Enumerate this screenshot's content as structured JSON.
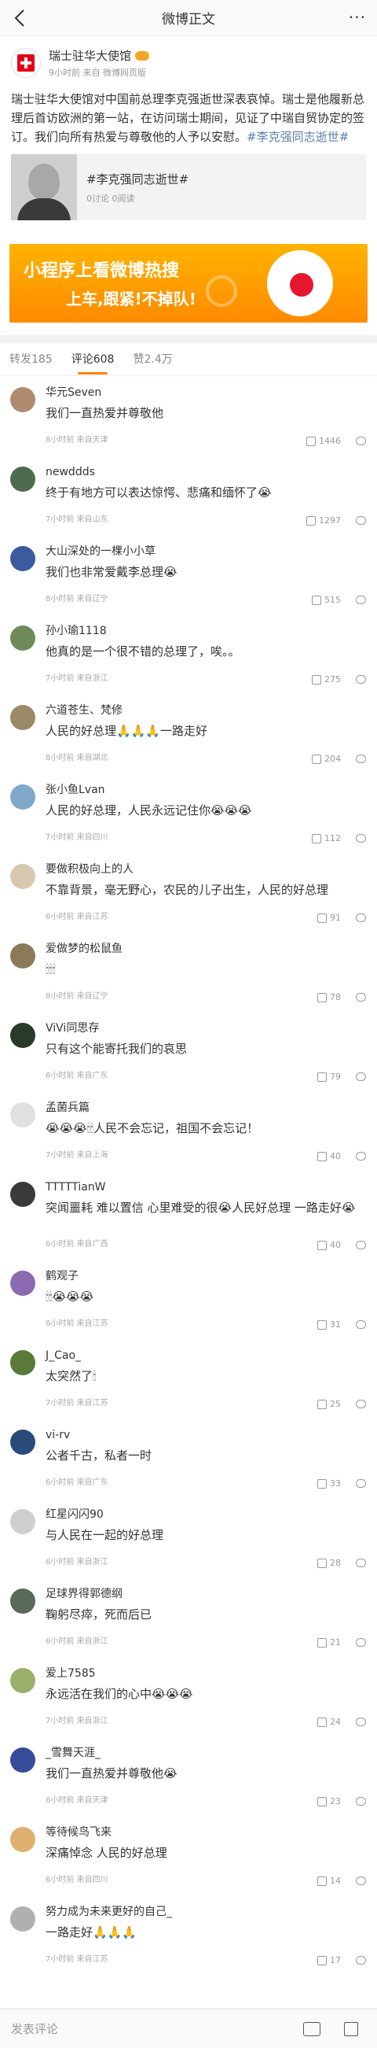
{
  "nav": {
    "title": "微博正文",
    "back_icon": "back-arrow-icon",
    "more_icon": "more-dots-icon"
  },
  "post": {
    "author": "瑞士驻华大使馆",
    "sub": "9小时前 来自 微博网页版",
    "text": "瑞士驻华大使馆对中国前总理李克强逝世深表哀悼。瑞士是他履新总理后首访欧洲的第一站，在访问瑞士期间，见证了中瑞自贸协定的签订。我们向所有热爱与尊敬他的人予以安慰。",
    "hashtag": "#李克强同志逝世#",
    "topic_title": "#李克强同志逝世#",
    "topic_sub": "0讨论 0阅读"
  },
  "ad": {
    "line1": "小程序上看微博热搜",
    "line2": "上车,跟紧!不掉队!"
  },
  "tabs": [
    {
      "label": "转发185"
    },
    {
      "label": "评论608"
    },
    {
      "label": "赞2.4万"
    }
  ],
  "comments": [
    {
      "name": "华元Seven",
      "text": "我们一直热爱并尊敬他",
      "meta": "8小时前 来自天津",
      "likes": "1446",
      "avatar_color": "#b08a6e"
    },
    {
      "name": "newddds",
      "text": "终于有地方可以表达惊愕、悲痛和缅怀了😭",
      "meta": "7小时前 来自山东",
      "likes": "1297",
      "avatar_color": "#4f6b4f"
    },
    {
      "name": "大山深处的一棵小小草",
      "text": "我们也非常爱戴李总理😭",
      "meta": "8小时前 来自辽宁",
      "likes": "515",
      "avatar_color": "#3b5b9e"
    },
    {
      "name": "孙小瑜1118",
      "text": "他真的是一个很不错的总理了，唉。。",
      "meta": "7小时前 来自浙江",
      "likes": "275",
      "avatar_color": "#6e8a5a"
    },
    {
      "name": "六道苍生、梵修",
      "text": "人民的好总理🙏🙏🙏一路走好",
      "meta": "8小时前 来自湖北",
      "likes": "204",
      "avatar_color": "#9a8a6a"
    },
    {
      "name": "张小鱼Lvan",
      "text": "人民的好总理，人民永远记住你😭😭😭",
      "meta": "7小时前 来自四川",
      "likes": "112",
      "avatar_color": "#7fa8c9"
    },
    {
      "name": "要做积极向上的人",
      "text": "不靠背景，毫无野心，农民的儿子出生，人民的好总理",
      "meta": "6小时前 来自江苏",
      "likes": "91",
      "avatar_color": "#d9c8b0"
    },
    {
      "name": "爱做梦的松鼠鱼",
      "text": "🕯🕯🕯",
      "meta": "8小时前 来自辽宁",
      "likes": "78",
      "avatar_color": "#8a7a5a"
    },
    {
      "name": "ViVi同思存",
      "text": "只有这个能寄托我们的哀思",
      "meta": "6小时前 来自广东",
      "likes": "79",
      "avatar_color": "#2a3a2a"
    },
    {
      "name": "孟菌兵篇",
      "text": "😭😭😭🕯🕯人民不会忘记，祖国不会忘记！",
      "meta": "7小时前 来自上海",
      "likes": "40",
      "avatar_color": "#e0e0e0"
    },
    {
      "name": "TTTTTianW",
      "text": "突闻噩耗 难以置信 心里难受的很😭人民好总理 一路走好😭",
      "meta": "6小时前 来自广西",
      "likes": "40",
      "avatar_color": "#3a3a3a"
    },
    {
      "name": "鹤观子",
      "text": "🕯🕯😭😭😭",
      "meta": "6小时前 来自江苏",
      "likes": "31",
      "avatar_color": "#8a6ab0"
    },
    {
      "name": "J_Cao_",
      "text": "太突然了🕯",
      "meta": "7小时前 来自江苏",
      "likes": "25",
      "avatar_color": "#5a7a3a"
    },
    {
      "name": "vi-rv",
      "text": "公者千古，私者一时",
      "meta": "6小时前 来自广东",
      "likes": "33",
      "avatar_color": "#2a4a7a"
    },
    {
      "name": "红星闪闪90",
      "text": "与人民在一起的好总理",
      "meta": "6小时前 来自浙江",
      "likes": "28",
      "avatar_color": "#cfcfcf"
    },
    {
      "name": "足球界得郭德纲",
      "text": "鞠躬尽瘁，死而后已",
      "meta": "6小时前 来自浙江",
      "likes": "21",
      "avatar_color": "#5a6a5a"
    },
    {
      "name": "爱上7585",
      "text": "永远活在我们的心中😭😭😭",
      "meta": "7小时前 来自浙江",
      "likes": "24",
      "avatar_color": "#9ab06a"
    },
    {
      "name": "_雪舞天涯_",
      "text": "我们一直热爱并尊敬他😭",
      "meta": "6小时前 来自天津",
      "likes": "23",
      "avatar_color": "#3a4a9a"
    },
    {
      "name": "等待候鸟飞来",
      "text": "深痛悼念 人民的好总理",
      "meta": "6小时前 来自四川",
      "likes": "14",
      "avatar_color": "#e0b070"
    },
    {
      "name": "努力成为未来更好的自己_",
      "text": "一路走好🙏🙏🙏",
      "meta": "7小时前 来自江苏",
      "likes": "17",
      "avatar_color": "#b0b0b0"
    }
  ],
  "bottom": {
    "placeholder": "发表评论",
    "repost_icon": "repost-icon",
    "like_icon": "like-icon"
  }
}
